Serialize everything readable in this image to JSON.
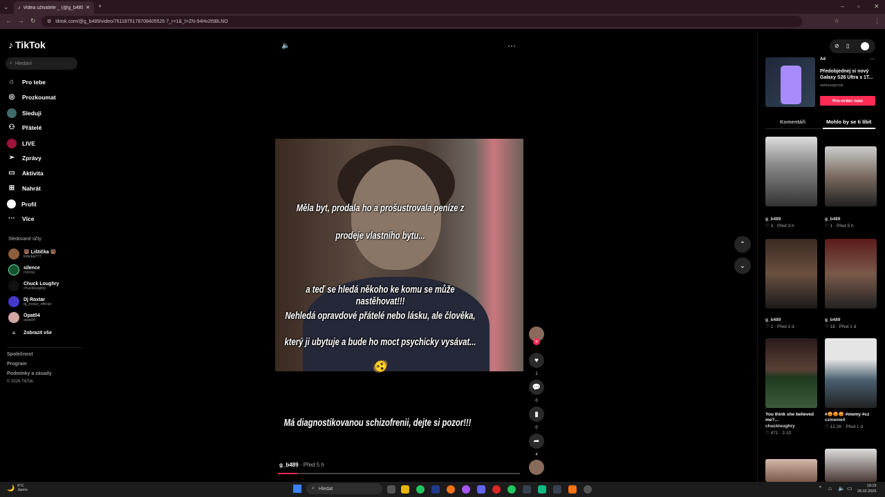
{
  "browser": {
    "tab_title": "Videa uživatele _ (@g_b489) s...",
    "url": "tiktok.com/@g_b489/video/7611875178708405526 7_r=1&_t=ZN-94Hv2t5BLNO"
  },
  "sidebar": {
    "logo": "TikTok",
    "search_placeholder": "Hledání",
    "items": [
      {
        "label": "Pro tebe",
        "icon": "home-icon"
      },
      {
        "label": "Prozkoumat",
        "icon": "compass-icon"
      },
      {
        "label": "Sleduji",
        "icon": "following-icon"
      },
      {
        "label": "Přátelé",
        "icon": "friends-icon"
      },
      {
        "label": "LIVE",
        "icon": "live-icon"
      },
      {
        "label": "Zprávy",
        "icon": "messages-icon"
      },
      {
        "label": "Aktivita",
        "icon": "activity-icon"
      },
      {
        "label": "Nahrát",
        "icon": "upload-icon"
      },
      {
        "label": "Profil",
        "icon": "profile-icon"
      },
      {
        "label": "Více",
        "icon": "more-icon"
      }
    ],
    "followed_heading": "Sledované účty",
    "followed": [
      {
        "name": "🐻 Lištička 🐻",
        "handle": "listicka777"
      },
      {
        "name": "silence",
        "handle": "ro01xy"
      },
      {
        "name": "Chuck Loughry",
        "handle": "chuckloughry"
      },
      {
        "name": "Dj Roxtar",
        "handle": "dj_roxtar_official"
      },
      {
        "name": "Opat04",
        "handle": "opat04"
      }
    ],
    "show_all": "Zobrazit vše",
    "footer": [
      "Společnost",
      "Program",
      "Podmínky a zásady",
      "© 2026 TikTok"
    ]
  },
  "video": {
    "captions": [
      "Měla byt, prodala ho a prošustrovala peníze z",
      "prodeje vlastního bytu...",
      "a teď se hledá někoho ke komu se může nastěhovat!!!",
      "Nehledá opravdové přátelé nebo lásku, ale člověka,",
      "který ji ubytuje a bude ho moct psychicky vysávat...",
      "Má diagnostikovanou schizofrenii, dejte si pozor!!!"
    ],
    "emoji": "🫨",
    "username": "g_b489",
    "posted": " · Před 5 h",
    "progress": 0.08,
    "likes": "1",
    "comments": "0",
    "saves": "0",
    "shares": "4"
  },
  "ad": {
    "tag": "Ad",
    "title": "Předobjednej si nový Galaxy S26 Ultra s 1T...",
    "source": "samsungczsk",
    "cta": "Pre-order now"
  },
  "tabs": {
    "comments": "Komentáři",
    "suggested": "Mohlo by se ti líbit"
  },
  "suggested": [
    {
      "title": "g_b489",
      "meta": "♡ 3 · Před 3 h"
    },
    {
      "title": "g_b489",
      "meta": "♡ 1 · Před 5 h"
    },
    {
      "title": "g_b489",
      "meta": "♡ 1 · Před 1 d"
    },
    {
      "title": "g_b489",
      "meta": "♡ 18 · Před 1 d"
    },
    {
      "title": "You think she believed me?...",
      "user": "chuckloughry",
      "meta": "♡ 471 · 2-10"
    },
    {
      "title": "#😡😡😡 #memy #cz",
      "user": "czmeme4",
      "meta": "♡ 12.2K · Před 1 d"
    }
  ],
  "taskbar": {
    "weather_temp": "6°C",
    "weather_desc": "Jasno",
    "search": "Hledat",
    "time": "18:15",
    "date": "28.02.2026"
  }
}
